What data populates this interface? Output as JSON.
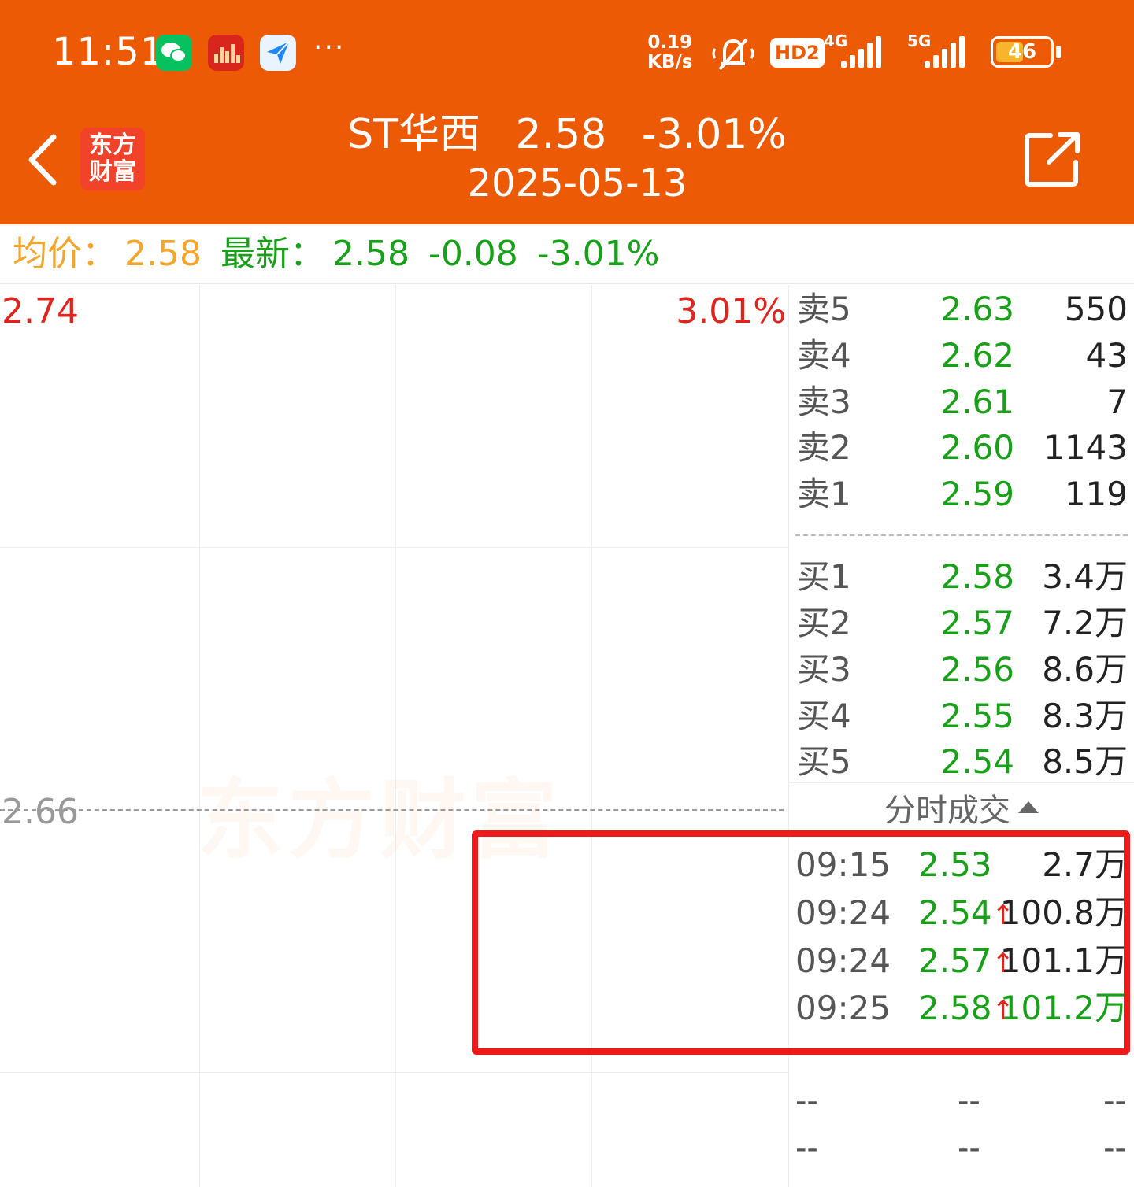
{
  "status_bar": {
    "time": "11:51",
    "more": "···",
    "net_speed_value": "0.19",
    "net_speed_unit": "KB/s",
    "hd_label": "HD2",
    "net1": "4G",
    "net2": "5G",
    "battery": "46"
  },
  "header": {
    "logo_line1": "东方",
    "logo_line2": "财富",
    "stock_name": "ST华西",
    "price": "2.58",
    "change_pct": "-3.01%",
    "date": "2025-05-13"
  },
  "summary": {
    "avg_label": "均价：",
    "avg_value": "2.58",
    "latest_label": "最新：",
    "latest_value": "2.58",
    "change": "-0.08",
    "change_pct": "-3.01%"
  },
  "chart": {
    "y_top": "2.74",
    "y_mid": "2.66",
    "pct_top": "3.01%",
    "watermark": "东方财富"
  },
  "order_book": {
    "sell": [
      {
        "label": "卖5",
        "price": "2.63",
        "vol": "550"
      },
      {
        "label": "卖4",
        "price": "2.62",
        "vol": "43"
      },
      {
        "label": "卖3",
        "price": "2.61",
        "vol": "7"
      },
      {
        "label": "卖2",
        "price": "2.60",
        "vol": "1143"
      },
      {
        "label": "卖1",
        "price": "2.59",
        "vol": "119"
      }
    ],
    "buy": [
      {
        "label": "买1",
        "price": "2.58",
        "vol": "3.4万"
      },
      {
        "label": "买2",
        "price": "2.57",
        "vol": "7.2万"
      },
      {
        "label": "买3",
        "price": "2.56",
        "vol": "8.6万"
      },
      {
        "label": "买4",
        "price": "2.55",
        "vol": "8.3万"
      },
      {
        "label": "买5",
        "price": "2.54",
        "vol": "8.5万"
      }
    ]
  },
  "ticks": {
    "header": "分时成交",
    "rows": [
      {
        "time": "09:15",
        "price": "2.53",
        "arrow": "",
        "vol": "2.7万"
      },
      {
        "time": "09:24",
        "price": "2.54",
        "arrow": "↑",
        "vol": "100.8万"
      },
      {
        "time": "09:24",
        "price": "2.57",
        "arrow": "↑",
        "vol": "101.1万"
      },
      {
        "time": "09:25",
        "price": "2.58",
        "arrow": "↑",
        "vol": "101.2万"
      }
    ],
    "empty_rows": [
      {
        "c1": "--",
        "c2": "--",
        "c3": "--"
      },
      {
        "c1": "--",
        "c2": "--",
        "c3": "--"
      }
    ]
  },
  "colors": {
    "brand_orange": "#ec5a06",
    "up_red": "#e0241c",
    "down_green": "#18a018",
    "avg_orange": "#f4a52b",
    "highlight_red": "#ee1a1a"
  }
}
